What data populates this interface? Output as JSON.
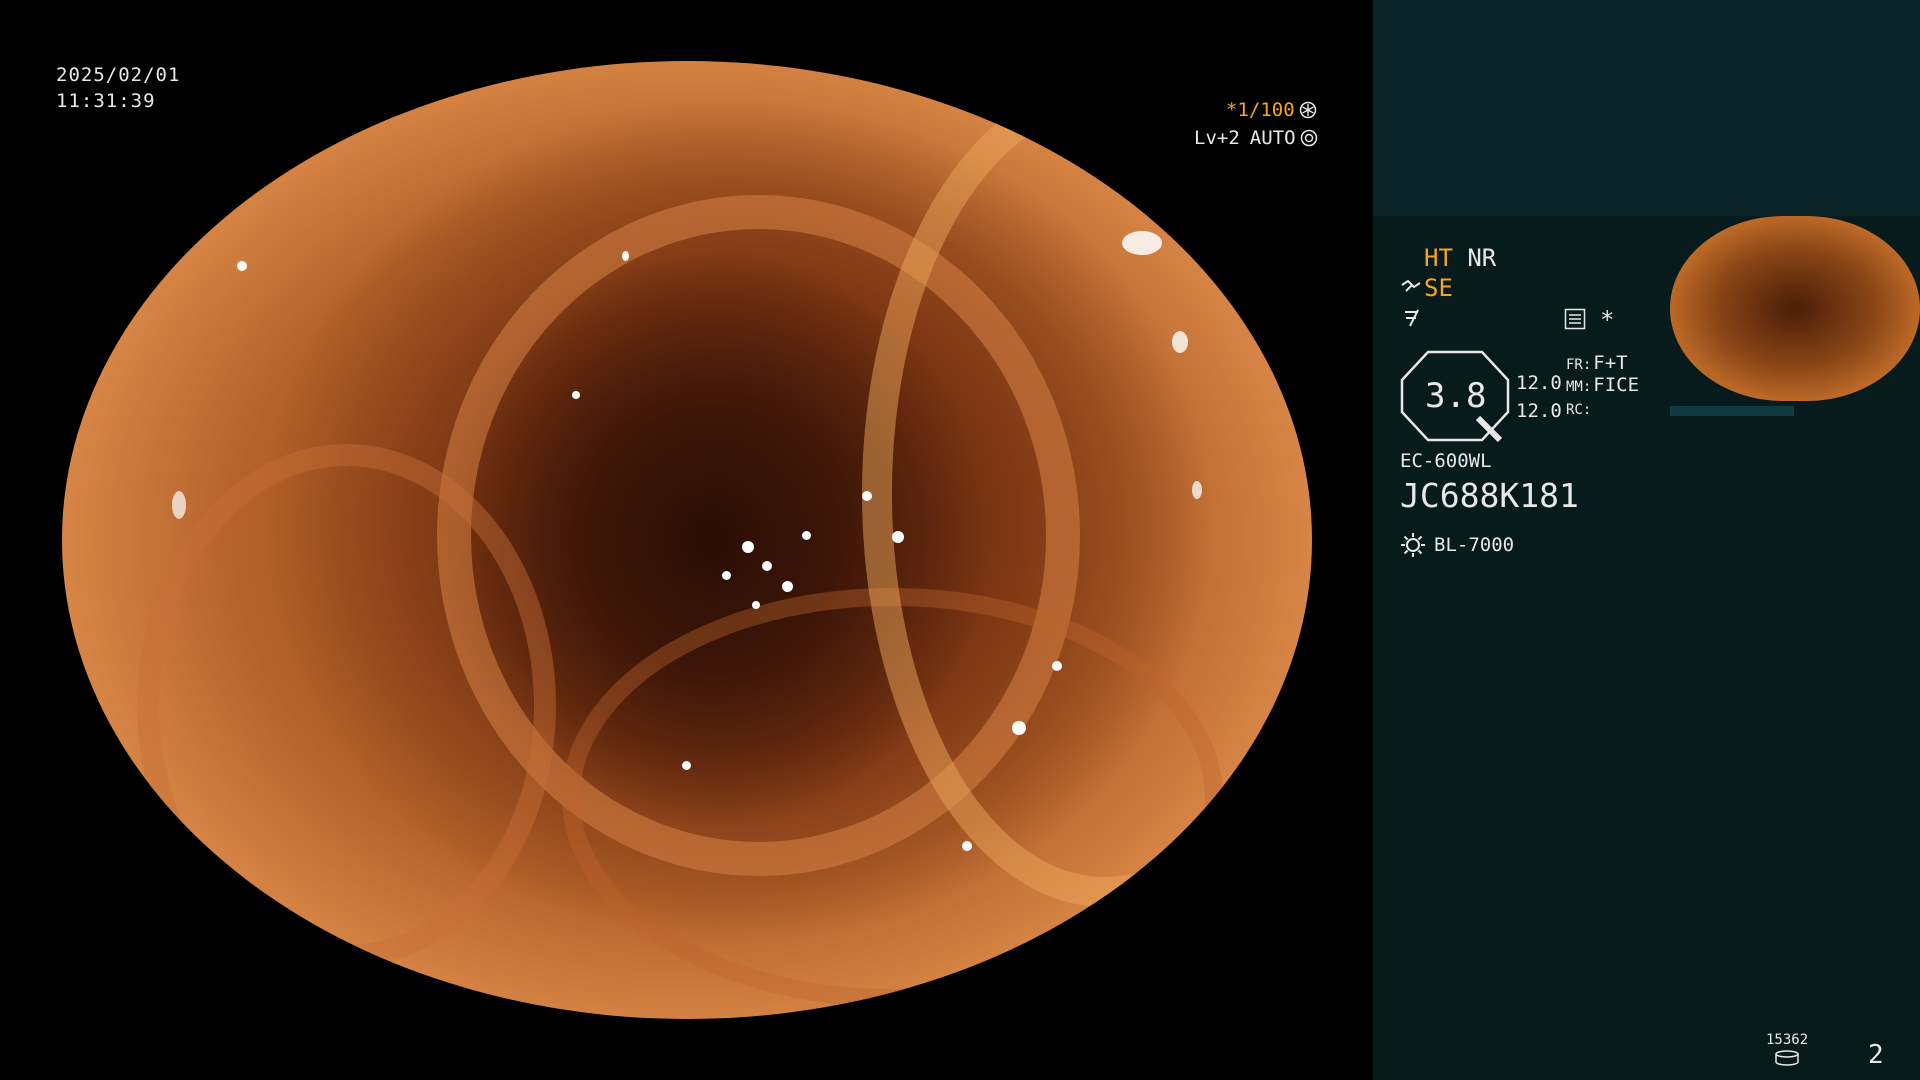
{
  "overlay": {
    "date": "2025/02/01",
    "time": "11:31:39",
    "shutter": "*1/100",
    "level": "Lv+2",
    "iris": "AUTO"
  },
  "panel": {
    "ht": "HT",
    "nr": "NR",
    "se": "SE",
    "star": "*",
    "zoom": "3.8",
    "val1": "12.0",
    "val2": "12.0",
    "fr_label": "FR:",
    "fr_value": "F+T",
    "mm_label": "MM:",
    "mm_value": "FICE",
    "rc_label": "RC:",
    "scope_model": "EC-600WL",
    "serial": "JC688K181",
    "light_source": "BL-7000",
    "count": "15362",
    "page": "2"
  },
  "colors": {
    "accent_yellow": "#f5a623",
    "text_white": "#e8e8e8",
    "panel_bg": "#071a1c",
    "panel_top_bg": "#0a2428"
  },
  "icons": {
    "shutter": "asterisk-circle-icon",
    "iris": "iris-icon",
    "structure": "structure-enhance-icon",
    "color": "color-enhance-icon",
    "menu": "list-icon",
    "zoom": "zoom-octagon-icon",
    "light": "sun-icon",
    "storage": "disk-icon"
  }
}
